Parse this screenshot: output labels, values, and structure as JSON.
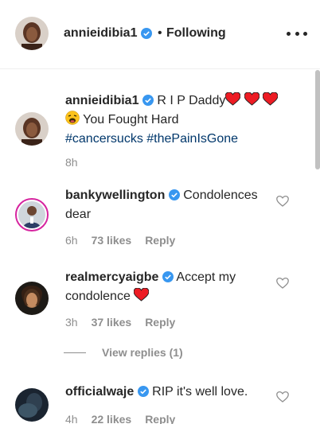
{
  "header": {
    "username": "annieidibia1",
    "separator": "•",
    "follow_status": "Following"
  },
  "caption": {
    "username": "annieidibia1",
    "text_1": "R I P Daddy",
    "text_2": "You Fought Hard",
    "hashtag_1": "#cancersucks",
    "hashtag_2": "#thePainIsGone",
    "time": "8h"
  },
  "comments": [
    {
      "username": "bankywellington",
      "text": "Condolences dear",
      "time": "6h",
      "likes": "73 likes",
      "reply_label": "Reply"
    },
    {
      "username": "realmercyaigbe",
      "text": "Accept my condolence",
      "time": "3h",
      "likes": "37 likes",
      "reply_label": "Reply",
      "view_replies": "View replies (1)"
    },
    {
      "username": "officialwaje",
      "text": "RIP it's well love.",
      "time": "4h",
      "likes": "22 likes",
      "reply_label": "Reply"
    }
  ],
  "colors": {
    "verified": "#3897f0",
    "heart": "#ed1c24",
    "hashtag": "#00376b",
    "muted": "#8e8e8e"
  }
}
